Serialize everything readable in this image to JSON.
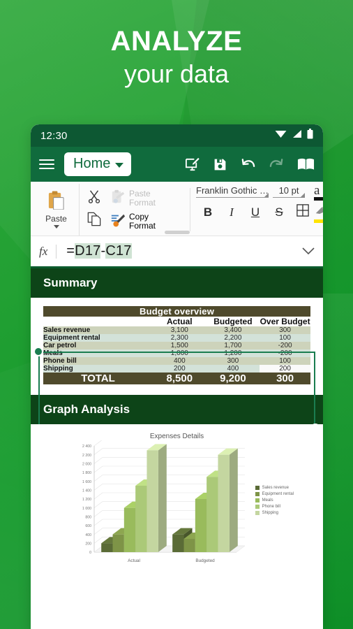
{
  "hero": {
    "line1": "ANALYZE",
    "line2": "your data"
  },
  "statusbar": {
    "time": "12:30",
    "icons": [
      "wifi-icon",
      "signal-icon",
      "battery-icon"
    ]
  },
  "appbar": {
    "menu_icon": "hamburger-icon",
    "tab_label": "Home",
    "actions": [
      {
        "name": "annotate-screen-icon"
      },
      {
        "name": "save-icon"
      },
      {
        "name": "undo-icon"
      },
      {
        "name": "redo-icon"
      },
      {
        "name": "read-mode-icon"
      }
    ]
  },
  "ribbon": {
    "paste_label": "Paste",
    "cut_icon": "scissors-icon",
    "copy_icon": "copy-icon",
    "paste_format_line1": "Paste",
    "paste_format_line2": "Format",
    "copy_format_line1": "Copy",
    "copy_format_line2": "Format",
    "font_name": "Franklin Gothic …",
    "font_size": "10 pt",
    "bold": "B",
    "italic": "I",
    "underline": "U",
    "strikethrough": "S",
    "borders_icon": "borders-icon",
    "font_color_glyph": "a",
    "font_color": "#111111",
    "highlight_color": "#ffe400"
  },
  "formulabar": {
    "fx_label": "fx",
    "formula_prefix": "=",
    "ref1": "D17",
    "operator": "-",
    "ref2": "C17",
    "expand_icon": "chevron-down-icon"
  },
  "sheet": {
    "sections": [
      {
        "title": "Summary"
      },
      {
        "title": "Graph Analysis"
      }
    ],
    "table": {
      "title": "Budget overview",
      "columns": [
        "",
        "Actual",
        "Budgeted",
        "Over Budget"
      ],
      "rows": [
        {
          "label": "Sales revenue",
          "actual": "3,100",
          "budgeted": "3,400",
          "over": "300"
        },
        {
          "label": "Equipment rental",
          "actual": "2,300",
          "budgeted": "2,200",
          "over": "100"
        },
        {
          "label": "Car petrol",
          "actual": "1,500",
          "budgeted": "1,700",
          "over": "-200"
        },
        {
          "label": "Meals",
          "actual": "1,000",
          "budgeted": "1,200",
          "over": "-200"
        },
        {
          "label": "Phone bill",
          "actual": "400",
          "budgeted": "300",
          "over": "100"
        },
        {
          "label": "Shipping",
          "actual": "200",
          "budgeted": "400",
          "over": "200"
        }
      ],
      "total": {
        "label": "TOTAL",
        "actual": "8,500",
        "budgeted": "9,200",
        "over": "300"
      }
    }
  },
  "chart_data": {
    "type": "bar",
    "title": "Expenses Details",
    "xlabel": "",
    "ylabel": "",
    "categories": [
      "Actual",
      "Budgeted"
    ],
    "series": [
      {
        "name": "Sales revenue",
        "color": "#5a6b36",
        "values": [
          200,
          400
        ]
      },
      {
        "name": "Equipment rental",
        "color": "#7e9447",
        "values": [
          400,
          300
        ]
      },
      {
        "name": "Meals",
        "color": "#99bb5c",
        "values": [
          1000,
          1200
        ]
      },
      {
        "name": "Phone bill",
        "color": "#abc978",
        "values": [
          1500,
          1700
        ]
      },
      {
        "name": "Shipping",
        "color": "#c4d6a0",
        "values": [
          2300,
          2200
        ]
      }
    ],
    "ylim": [
      0,
      2400
    ],
    "yticks": [
      "0",
      "200",
      "400",
      "600",
      "800",
      "1 000",
      "1 200",
      "1 400",
      "1 600",
      "1 800",
      "2 000",
      "2 200",
      "2 400"
    ],
    "grid": true,
    "legend_position": "right"
  },
  "colors": {
    "brand_green": "#106b3d",
    "status_green": "#0d5833",
    "band_green": "#0d4418",
    "table_header_olive": "#4f4a2c",
    "selection_green": "#1a7d50"
  }
}
